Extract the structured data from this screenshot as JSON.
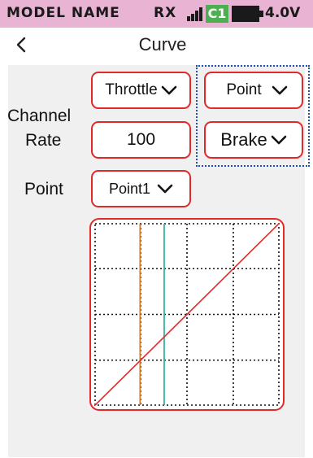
{
  "status_bar": {
    "model_label": "MODEL NAME",
    "receiver_label": "RX",
    "channel_badge": "C1",
    "voltage": "4.0V",
    "colors": {
      "background": "#e9b3d3",
      "badge": "#4caf50"
    }
  },
  "header": {
    "title": "Curve",
    "back_icon": "chevron-left-icon"
  },
  "form": {
    "channel": {
      "label": "Channel",
      "value": "Throttle"
    },
    "rate": {
      "label": "Rate",
      "value": "100"
    },
    "point": {
      "label": "Point",
      "value": "Point1"
    },
    "mode_select": {
      "value": "Point"
    },
    "direction_select": {
      "value": "Brake"
    }
  },
  "curve": {
    "line_color": "#e02a2a",
    "marker_colors": [
      "#d9822b",
      "#2bb5a0"
    ],
    "grid_divisions": 4,
    "markers": [
      0.247,
      0.377
    ],
    "curve_points": [
      [
        0,
        0
      ],
      [
        1,
        1
      ]
    ]
  }
}
